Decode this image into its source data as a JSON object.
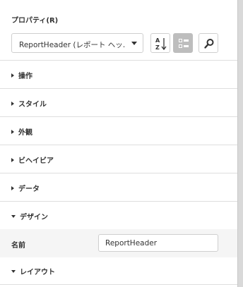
{
  "panel": {
    "title": "プロパティ(R)",
    "selector": {
      "value": "ReportHeader (レポート ヘッ…"
    },
    "buttons": [
      {
        "name": "sort-alphabetical",
        "icon": "sort-az-icon",
        "active": false
      },
      {
        "name": "categorized",
        "icon": "categorized-icon",
        "active": true
      },
      {
        "name": "search",
        "icon": "search-icon",
        "active": false
      }
    ],
    "sections": [
      {
        "label": "操作",
        "expanded": false
      },
      {
        "label": "スタイル",
        "expanded": false
      },
      {
        "label": "外観",
        "expanded": false
      },
      {
        "label": "ビヘイビア",
        "expanded": false
      },
      {
        "label": "データ",
        "expanded": false
      },
      {
        "label": "デザイン",
        "expanded": true
      },
      {
        "label": "レイアウト",
        "expanded": true
      }
    ],
    "design_props": [
      {
        "label": "名前",
        "value": "ReportHeader"
      }
    ]
  },
  "colors": {
    "active_button": "#bdbdbd",
    "row_highlight": "#f5f5f5",
    "separator": "#dedede"
  }
}
